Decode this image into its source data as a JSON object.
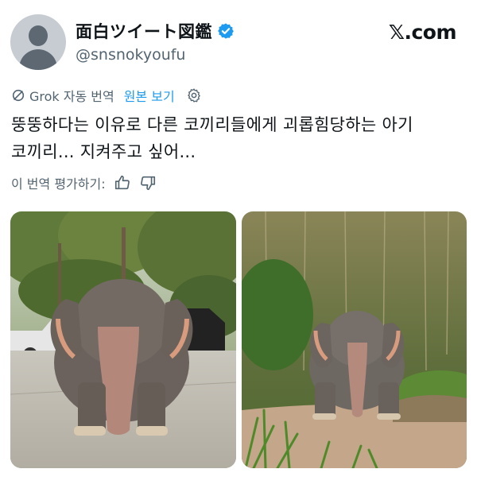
{
  "profile": {
    "display_name": "面白ツイート図鑑",
    "handle": "@snsnokyoufu",
    "avatar_icon": "default-avatar-icon",
    "verified_icon": "verified-badge-icon",
    "verified_color": "#1d9bf0"
  },
  "brand": {
    "logo_text": "𝕏.com"
  },
  "translation": {
    "grok_label": "Grok 자동 번역",
    "show_original": "원본 보기",
    "settings_icon": "gear-icon"
  },
  "tweet": {
    "text_line1": "뚱뚱하다는 이유로 다른 코끼리들에게 괴롭힘당하는 아기",
    "text_line2": "코끼리... 지켜주고 싶어..."
  },
  "rating": {
    "label": "이 번역 평가하기:",
    "like_icon": "thumbs-up-icon",
    "dislike_icon": "thumbs-down-icon"
  },
  "media": [
    {
      "description_icon": "elephant-parking-lot-photo"
    },
    {
      "description_icon": "elephant-forest-photo"
    }
  ],
  "colors": {
    "text": "#0f1419",
    "secondary": "#536471",
    "accent": "#1d9bf0"
  }
}
